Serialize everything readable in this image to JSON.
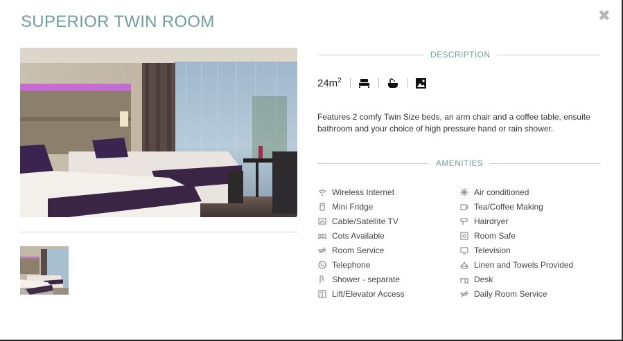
{
  "modal": {
    "title": "SUPERIOR TWIN ROOM",
    "close_symbol": "✖",
    "close_icon": "close-icon"
  },
  "description_section": {
    "heading": "DESCRIPTION",
    "size_value": "24m",
    "size_unit_exp": "2",
    "spec_icons": [
      "bed-icon",
      "bath-icon",
      "picture-view-icon"
    ],
    "text": "Features 2 comfy Twin Size beds, an arm chair and a coffee table, ensuite bathroom and your choice of high pressure hand or rain shower."
  },
  "amenities_section": {
    "heading": "AMENITIES",
    "items": [
      {
        "label": "Wireless Internet",
        "icon": "wifi-icon"
      },
      {
        "label": "Air conditioned",
        "icon": "snowflake-icon"
      },
      {
        "label": "Mini Fridge",
        "icon": "fridge-icon"
      },
      {
        "label": "Tea/Coffee Making",
        "icon": "coffee-cup-icon"
      },
      {
        "label": "Cable/Satellite TV",
        "icon": "satellite-tv-icon"
      },
      {
        "label": "Hairdryer",
        "icon": "hairdryer-icon"
      },
      {
        "label": "Cots Available",
        "icon": "cot-icon"
      },
      {
        "label": "Room Safe",
        "icon": "safe-icon"
      },
      {
        "label": "Room Service",
        "icon": "room-service-icon"
      },
      {
        "label": "Television",
        "icon": "television-icon"
      },
      {
        "label": "Telephone",
        "icon": "telephone-icon"
      },
      {
        "label": "Linen and Towels Provided",
        "icon": "linen-icon"
      },
      {
        "label": "Shower - separate",
        "icon": "shower-icon"
      },
      {
        "label": "Desk",
        "icon": "desk-icon"
      },
      {
        "label": "Lift/Elevator Access",
        "icon": "elevator-icon"
      },
      {
        "label": "Daily Room Service",
        "icon": "daily-service-icon"
      }
    ]
  },
  "colors": {
    "accent": "#6f9ea0",
    "divider": "#cfcfcf",
    "text": "#333333",
    "close": "#b8b8b8"
  }
}
